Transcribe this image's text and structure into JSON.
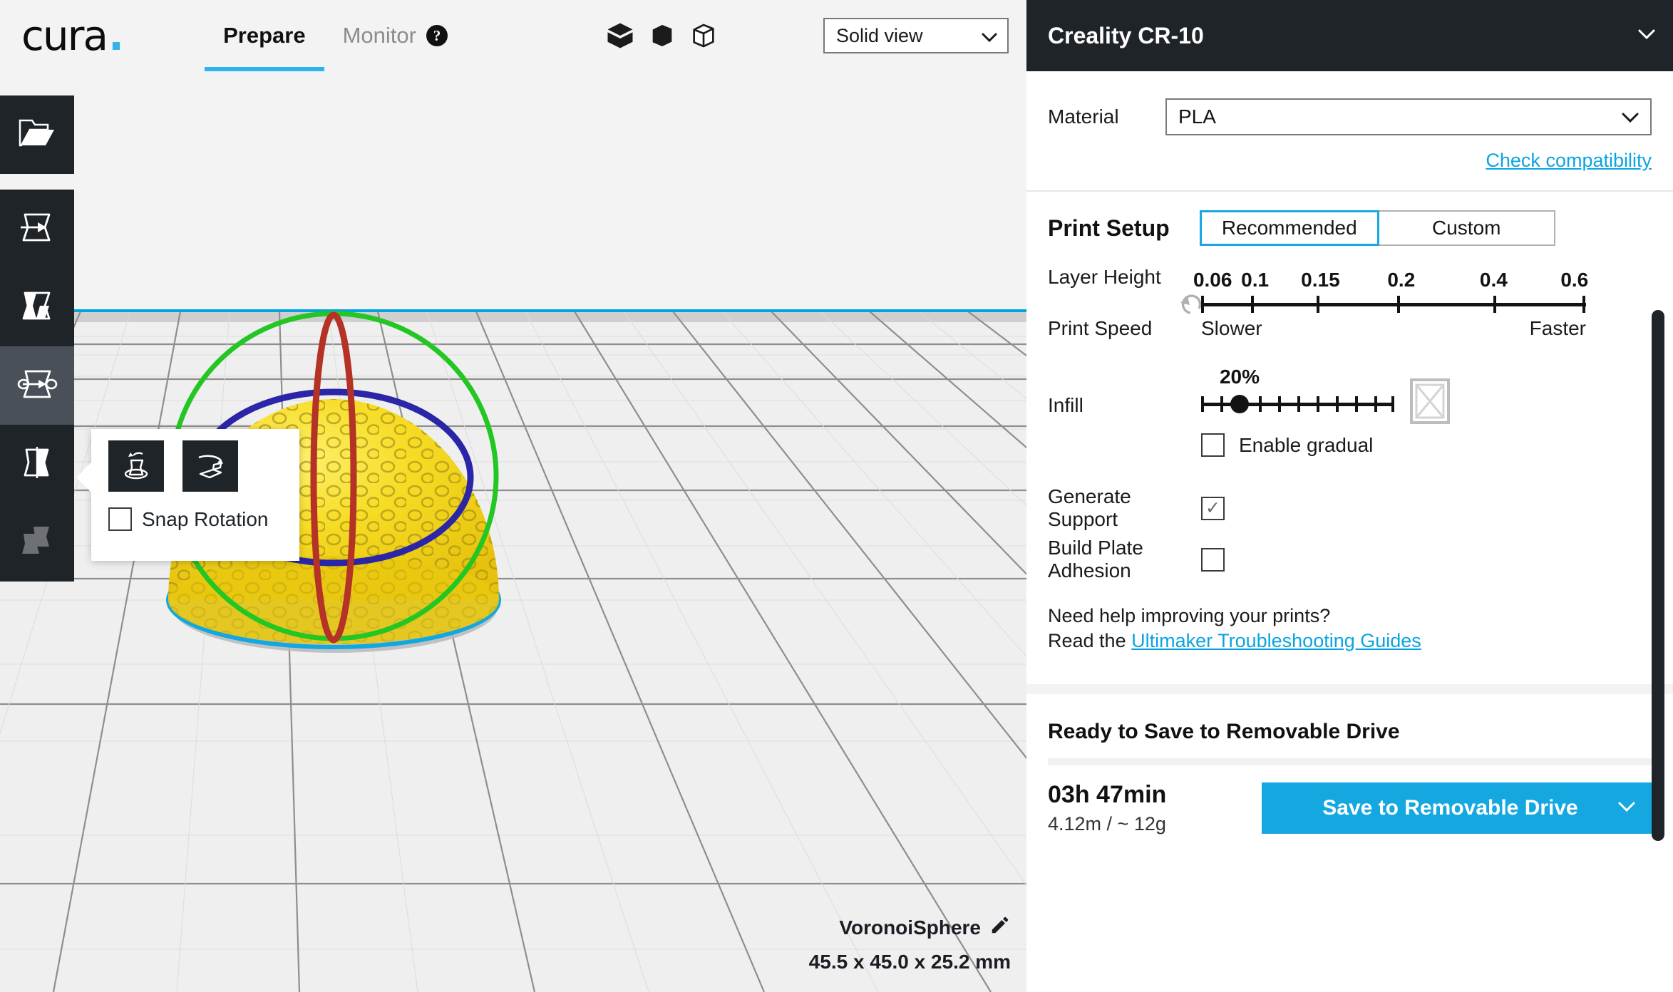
{
  "app": {
    "logo_text": "cura",
    "logo_dot": "."
  },
  "top_tabs": [
    {
      "label": "Prepare",
      "active": true
    },
    {
      "label": "Monitor",
      "active": false,
      "badge": "?"
    }
  ],
  "view_icons": [
    {
      "name": "solid-cube-icon"
    },
    {
      "name": "half-shaded-cube-icon"
    },
    {
      "name": "outline-cube-icon"
    }
  ],
  "view_select": {
    "value": "Solid view",
    "chevron": "chevron-down-icon"
  },
  "left_tools": [
    {
      "name": "open-file",
      "icon": "folder-open-icon",
      "selected": false,
      "disabled": false
    },
    {
      "name": "move",
      "icon": "move-model-icon",
      "selected": false,
      "disabled": false
    },
    {
      "name": "scale",
      "icon": "scale-model-icon",
      "selected": false,
      "disabled": false
    },
    {
      "name": "rotate",
      "icon": "rotate-model-icon",
      "selected": true,
      "disabled": false
    },
    {
      "name": "mirror",
      "icon": "mirror-model-icon",
      "selected": false,
      "disabled": false
    },
    {
      "name": "per-model-settings",
      "icon": "per-model-settings-icon",
      "selected": false,
      "disabled": true
    }
  ],
  "rotate_popup": {
    "buttons": [
      {
        "name": "lay-flat",
        "icon": "lay-flat-icon"
      },
      {
        "name": "select-face-to-align",
        "icon": "align-face-icon"
      }
    ],
    "checkbox_label": "Snap Rotation",
    "checkbox_checked": false
  },
  "viewport": {
    "model_name": "VoronoiSphere",
    "model_dimensions": "45.5 x 45.0 x 25.2 mm",
    "edit_icon": "pencil-icon",
    "rotation_rings": {
      "x_ring_color": "#c0392b",
      "y_ring_color": "#2ecc2e",
      "z_ring_color": "#3427b0"
    },
    "model_color": "#f4d71b",
    "plate_edge_color": "#00a5df"
  },
  "printer": {
    "name": "Creality CR-10",
    "chevron": "chevron-down-icon"
  },
  "material": {
    "label": "Material",
    "value": "PLA",
    "check_compatibility": "Check compatibility"
  },
  "print_setup": {
    "title": "Print Setup",
    "modes": [
      {
        "label": "Recommended",
        "active": true
      },
      {
        "label": "Custom",
        "active": false
      }
    ],
    "layer_height": {
      "label": "Layer Height",
      "ticks": [
        "0.06",
        "0.1",
        "0.15",
        "0.2",
        "0.4",
        "0.6"
      ],
      "tick_positions": [
        0,
        13,
        30,
        51,
        76,
        100
      ],
      "reset_icon": "reset-arrow-icon"
    },
    "print_speed": {
      "label": "Print Speed",
      "slower": "Slower",
      "faster": "Faster"
    },
    "infill": {
      "label": "Infill",
      "value": "20%",
      "handle_percent": 20,
      "tick_count": 11,
      "gradual_label": "Enable gradual",
      "gradual_checked": false,
      "pattern_icon": "infill-pattern-icon"
    },
    "generate_support": {
      "label": "Generate Support",
      "checked": true,
      "check_mark": "✓"
    },
    "build_plate_adhesion": {
      "label": "Build Plate Adhesion",
      "checked": false
    }
  },
  "help": {
    "line1": "Need help improving your prints?",
    "line2_prefix": "Read the ",
    "line2_link": "Ultimaker Troubleshooting Guides"
  },
  "save": {
    "status": "Ready to Save to Removable Drive",
    "time": "03h 47min",
    "material_usage": "4.12m / ~ 12g",
    "button_label": "Save to Removable Drive",
    "button_chevron": "chevron-down-icon",
    "accent_color": "#15a8e0"
  }
}
